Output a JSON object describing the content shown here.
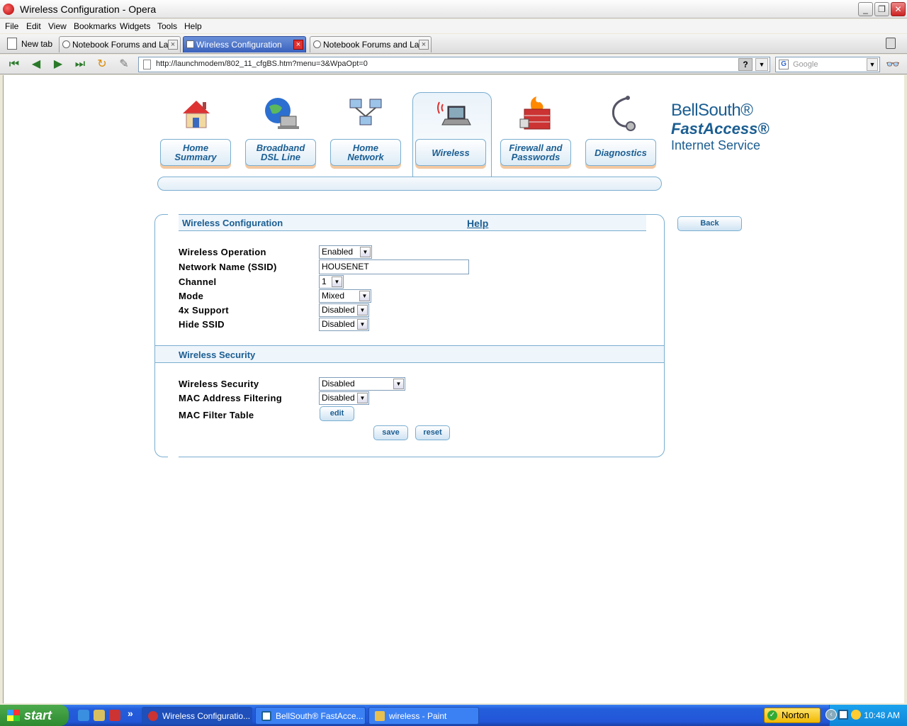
{
  "window": {
    "title": "Wireless Configuration - Opera"
  },
  "menubar": [
    "File",
    "Edit",
    "View",
    "Bookmarks",
    "Widgets",
    "Tools",
    "Help"
  ],
  "tabs": {
    "new_tab_label": "New tab",
    "items": [
      {
        "label": "Notebook Forums and La...",
        "active": false
      },
      {
        "label": "Wireless Configuration",
        "active": true
      },
      {
        "label": "Notebook Forums and La...",
        "active": false
      }
    ]
  },
  "address_bar": {
    "url": "http://launchmodem/802_11_cfgBS.htm?menu=3&WpaOpt=0",
    "help_glyph": "?"
  },
  "search": {
    "engine_glyph": "G",
    "placeholder": "Google"
  },
  "router_nav": {
    "tabs": [
      {
        "line1": "Home",
        "line2": "Summary",
        "icon": "house-icon"
      },
      {
        "line1": "Broadband",
        "line2": "DSL Line",
        "icon": "globe-laptop-icon"
      },
      {
        "line1": "Home",
        "line2": "Network",
        "icon": "network-computers-icon"
      },
      {
        "line1": "Wireless",
        "line2": "",
        "icon": "wireless-laptop-icon"
      },
      {
        "line1": "Firewall and",
        "line2": "Passwords",
        "icon": "firewall-icon"
      },
      {
        "line1": "Diagnostics",
        "line2": "",
        "icon": "stethoscope-icon"
      }
    ],
    "active_index": 3
  },
  "brand": {
    "line1": "BellSouth®",
    "line2": "FastAccess®",
    "line3": "Internet Service"
  },
  "content": {
    "back_label": "Back",
    "wireless_config": {
      "heading": "Wireless Configuration",
      "help_link": "Help",
      "fields": {
        "wireless_operation": {
          "label": "Wireless Operation",
          "value": "Enabled"
        },
        "ssid": {
          "label": "Network Name (SSID)",
          "value": "HOUSENET"
        },
        "channel": {
          "label": "Channel",
          "value": "1"
        },
        "mode": {
          "label": "Mode",
          "value": "Mixed"
        },
        "support_4x": {
          "label": "4x Support",
          "value": "Disabled"
        },
        "hide_ssid": {
          "label": "Hide SSID",
          "value": "Disabled"
        }
      }
    },
    "wireless_security": {
      "heading": "Wireless Security",
      "fields": {
        "security": {
          "label": "Wireless Security",
          "value": "Disabled"
        },
        "mac_filtering": {
          "label": "MAC Address Filtering",
          "value": "Disabled"
        },
        "mac_table": {
          "label": "MAC Filter Table",
          "button": "edit"
        }
      }
    },
    "save_label": "save",
    "reset_label": "reset"
  },
  "taskbar": {
    "start_label": "start",
    "more_glyph": "»",
    "items": [
      {
        "label": "Wireless Configuratio...",
        "active": true
      },
      {
        "label": "BellSouth® FastAcce...",
        "active": false
      },
      {
        "label": "wireless - Paint",
        "active": false
      }
    ],
    "norton_label": "Norton",
    "clock": "10:48 AM"
  }
}
